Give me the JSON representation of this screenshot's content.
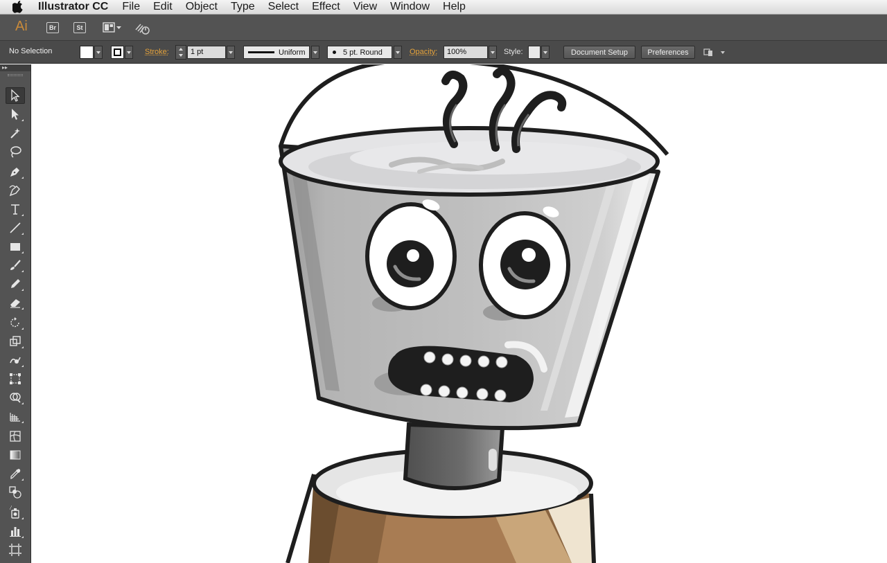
{
  "menubar": {
    "app_name": "Illustrator CC",
    "items": [
      "File",
      "Edit",
      "Object",
      "Type",
      "Select",
      "Effect",
      "View",
      "Window",
      "Help"
    ]
  },
  "appbar": {
    "logo": "Ai",
    "bridge_label": "Br",
    "stock_label": "St"
  },
  "control_bar": {
    "selection_status": "No Selection",
    "stroke_label": "Stroke:",
    "stroke_weight": "1 pt",
    "profile": "Uniform",
    "brush": "5 pt. Round",
    "opacity_label": "Opacity:",
    "opacity_value": "100%",
    "style_label": "Style:",
    "document_setup": "Document Setup",
    "preferences": "Preferences"
  },
  "tools_panel": {
    "collapse_glyph": "▸▸",
    "tools": [
      "selection-tool",
      "direct-selection-tool",
      "magic-wand-tool",
      "lasso-tool",
      "pen-tool",
      "curvature-tool",
      "type-tool",
      "line-tool",
      "rectangle-tool",
      "paintbrush-tool",
      "pencil-tool",
      "eraser-tool",
      "rotate-tool",
      "scale-tool",
      "warp-tool",
      "free-transform-tool",
      "shape-builder-tool",
      "perspective-grid-tool",
      "mesh-tool",
      "gradient-tool",
      "eyedropper-tool",
      "blend-tool",
      "symbol-sprayer-tool",
      "graph-tool",
      "artboard-tool"
    ]
  },
  "colors": {
    "accent_orange": "#e6a33b",
    "panel_bg": "#535353",
    "control_bg": "#4a4a4a"
  }
}
